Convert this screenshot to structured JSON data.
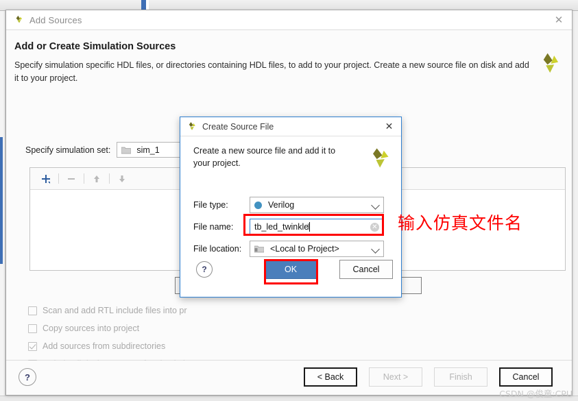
{
  "wizard": {
    "title": "Add Sources",
    "close_icon": "close-icon",
    "heading": "Add or Create Simulation Sources",
    "description": "Specify simulation specific HDL files, or directories containing HDL files, to add to your project. Create a new source file on disk and add it to your project.",
    "sim_set": {
      "label": "Specify simulation set:",
      "value": "sim_1",
      "folder_icon": "folder-icon"
    },
    "toolbar": {
      "add_icon": "plus-icon",
      "remove_icon": "minus-icon",
      "move_up_icon": "arrow-up-icon",
      "move_down_icon": "arrow-down-icon"
    },
    "checkboxes": [
      {
        "label": "Scan and add RTL include files into pr",
        "checked": false,
        "mnemonic": "i"
      },
      {
        "label": "Copy sources into project",
        "checked": false,
        "mnemonic": "s"
      },
      {
        "label": "Add sources from subdirectories",
        "checked": true,
        "mnemonic": "u"
      },
      {
        "label": "Include all design sources for simulation",
        "checked": true,
        "mnemonic": "o"
      }
    ],
    "footer": {
      "help_label": "?",
      "back_label": "< Back",
      "next_label": "Next >",
      "finish_label": "Finish",
      "cancel_label": "Cancel"
    }
  },
  "modal": {
    "title": "Create Source File",
    "close_icon": "close-icon",
    "description": "Create a new source file and add it to your project.",
    "logo_icon": "vivado-logo-icon",
    "fields": {
      "file_type": {
        "label": "File type:",
        "value": "Verilog",
        "dot_color": "#4292c1",
        "chevron_icon": "chevron-down-icon"
      },
      "file_name": {
        "label": "File name:",
        "value": "tb_led_twinkle",
        "placeholder": "",
        "clear_icon": "clear-icon"
      },
      "file_location": {
        "label": "File location:",
        "value": "<Local to Project>",
        "folder_icon": "folder-icon",
        "chevron_icon": "chevron-down-icon"
      }
    },
    "buttons": {
      "help_label": "?",
      "ok_label": "OK",
      "cancel_label": "Cancel"
    }
  },
  "annotation": {
    "text": "输入仿真文件名",
    "color": "#fe0000"
  },
  "watermark": "CSDN @俊童:CPU"
}
